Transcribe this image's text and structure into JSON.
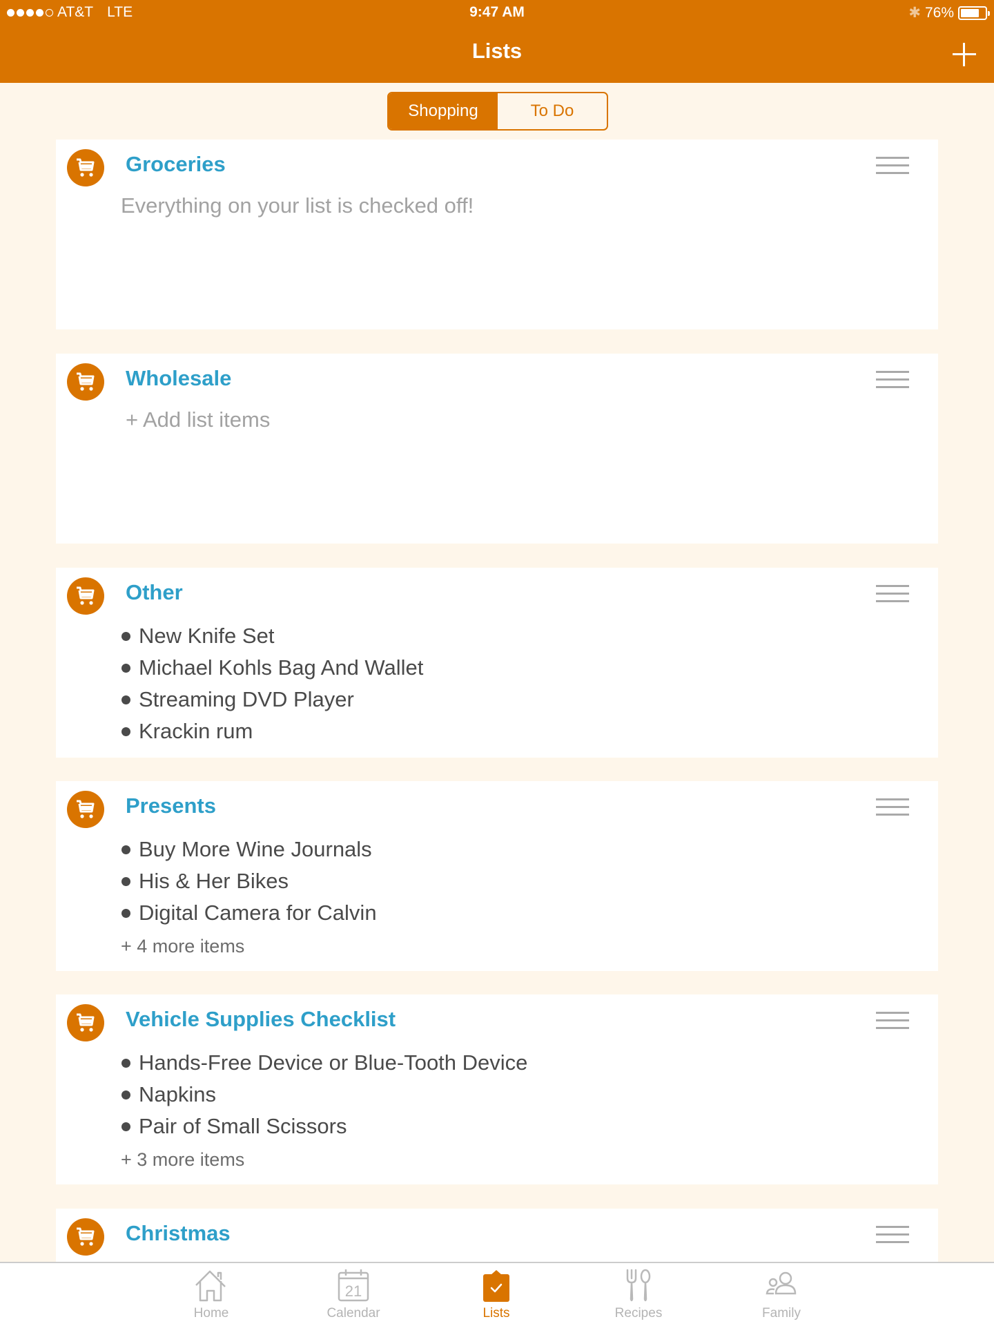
{
  "status_bar": {
    "carrier": "AT&T",
    "network": "LTE",
    "signal_bars_filled": 4,
    "signal_bars_total": 5,
    "time": "9:47 AM",
    "battery_percent_label": "76%",
    "battery_level": 0.76,
    "bluetooth_icon": "bluetooth-icon"
  },
  "nav": {
    "title": "Lists",
    "add_icon": "plus-icon"
  },
  "segments": [
    {
      "label": "Shopping",
      "active": true
    },
    {
      "label": "To Do",
      "active": false
    }
  ],
  "colors": {
    "brand": "#D97400",
    "title_blue": "#2E9FC9",
    "background": "#FEF6EA"
  },
  "lists": [
    {
      "title": "Groceries",
      "icon": "cart-icon",
      "message": "Everything on your list is checked off!"
    },
    {
      "title": "Wholesale",
      "icon": "cart-icon",
      "add_label": "+ Add list items"
    },
    {
      "title": "Other",
      "icon": "cart-icon",
      "items": [
        "New Knife Set",
        "Michael Kohls Bag And Wallet",
        "Streaming DVD Player",
        "Krackin rum"
      ]
    },
    {
      "title": "Presents",
      "icon": "cart-icon",
      "items": [
        "Buy More Wine Journals",
        "His & Her Bikes",
        "Digital Camera for Calvin"
      ],
      "more": "+ 4 more items"
    },
    {
      "title": "Vehicle Supplies Checklist",
      "icon": "cart-icon",
      "items": [
        "Hands-Free Device or Blue-Tooth Device",
        "Napkins",
        "Pair of Small Scissors"
      ],
      "more": "+ 3 more items"
    },
    {
      "title": "Christmas",
      "icon": "cart-icon"
    }
  ],
  "tabs": [
    {
      "label": "Home",
      "icon": "home-icon",
      "active": false
    },
    {
      "label": "Calendar",
      "icon": "calendar-icon",
      "calendar_day": "21",
      "active": false
    },
    {
      "label": "Lists",
      "icon": "clipboard-check-icon",
      "active": true
    },
    {
      "label": "Recipes",
      "icon": "fork-spoon-icon",
      "active": false
    },
    {
      "label": "Family",
      "icon": "family-icon",
      "active": false
    }
  ]
}
